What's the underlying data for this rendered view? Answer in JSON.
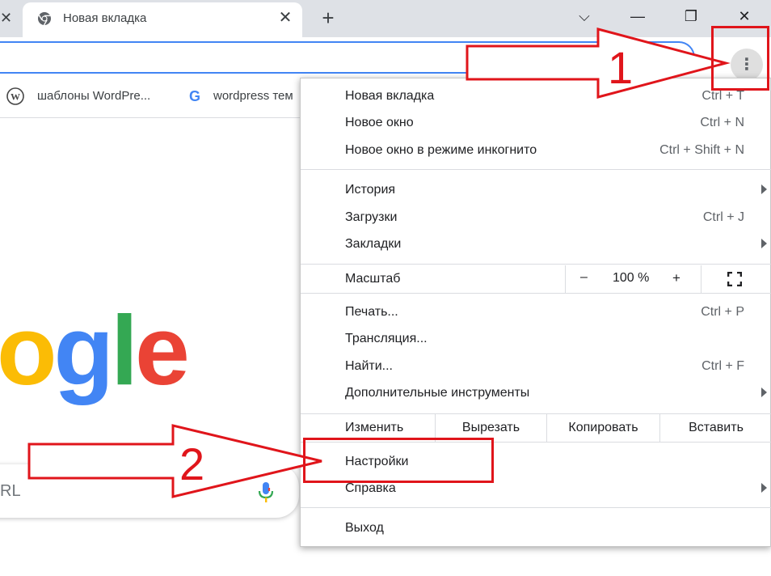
{
  "tab": {
    "title": "Новая вкладка",
    "close": "✕"
  },
  "new_tab_label": "+",
  "window": {
    "minimize": "—",
    "restore": "❐",
    "close": "✕",
    "tabsearch": "⌵"
  },
  "prev_tab_close": "✕",
  "menu_button": "⋮",
  "bookmarks": [
    {
      "label": "шаблоны WordPre...",
      "icon": "wordpress-icon"
    },
    {
      "label": "wordpress тем",
      "icon": "google-g-icon"
    }
  ],
  "page": {
    "logo": [
      "o",
      "g",
      "l",
      "e"
    ],
    "search_placeholder": "RL"
  },
  "menu": {
    "group1": [
      {
        "label": "Новая вкладка",
        "shortcut": "Ctrl + T"
      },
      {
        "label": "Новое окно",
        "shortcut": "Ctrl + N"
      },
      {
        "label": "Новое окно в режиме инкогнито",
        "shortcut": "Ctrl + Shift + N"
      }
    ],
    "group2": [
      {
        "label": "История",
        "shortcut": "",
        "submenu": true
      },
      {
        "label": "Загрузки",
        "shortcut": "Ctrl + J"
      },
      {
        "label": "Закладки",
        "shortcut": "",
        "submenu": true
      }
    ],
    "zoom": {
      "label": "Масштаб",
      "minus": "–",
      "value": "100 %",
      "plus": "+"
    },
    "group3": [
      {
        "label": "Печать...",
        "shortcut": "Ctrl + P"
      },
      {
        "label": "Трансляция...",
        "shortcut": ""
      },
      {
        "label": "Найти...",
        "shortcut": "Ctrl + F"
      },
      {
        "label": "Дополнительные инструменты",
        "shortcut": "",
        "submenu": true
      }
    ],
    "edit": {
      "label": "Изменить",
      "cut": "Вырезать",
      "copy": "Копировать",
      "paste": "Вставить"
    },
    "group4": [
      {
        "label": "Настройки"
      },
      {
        "label": "Справка",
        "submenu": true
      }
    ],
    "exit": "Выход"
  },
  "annotations": {
    "step1": "1",
    "step2": "2",
    "color": "#e0151b"
  },
  "colors": {
    "accent": "#4285f4",
    "tabstrip": "#dee1e6",
    "google_blue": "#4285f4",
    "google_red": "#ea4335",
    "google_yellow": "#fbbc05",
    "google_green": "#34a853"
  }
}
